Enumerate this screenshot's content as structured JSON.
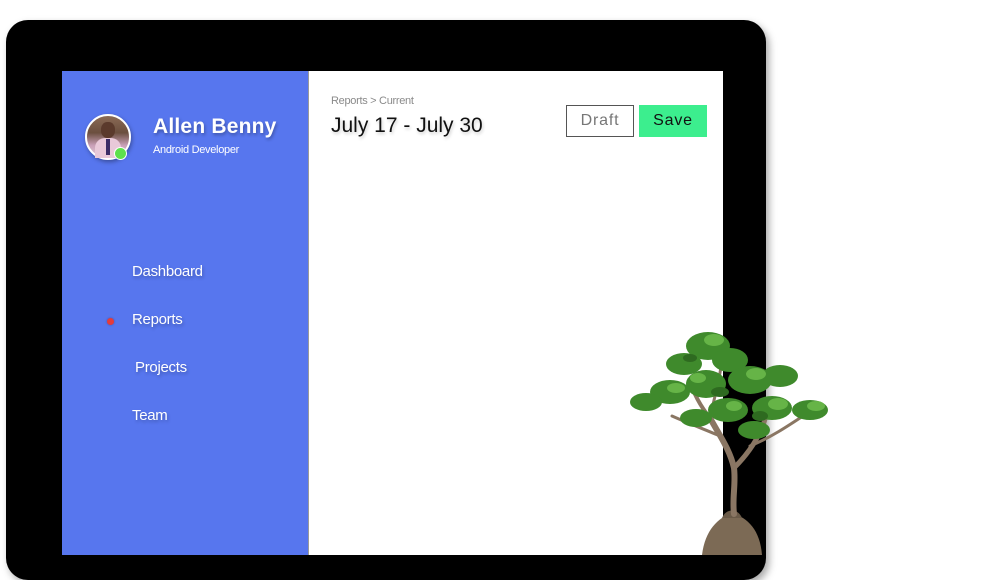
{
  "profile": {
    "name": "Allen Benny",
    "role": "Android Developer",
    "status": "online",
    "status_color": "#5ee04c"
  },
  "sidebar": {
    "background_color": "#5776ee",
    "items": [
      {
        "label": "Dashboard",
        "active": false
      },
      {
        "label": "Reports",
        "active": true
      },
      {
        "label": "Projects",
        "active": false
      },
      {
        "label": "Team",
        "active": false
      }
    ],
    "active_indicator_color": "#e53b3b"
  },
  "header": {
    "breadcrumb": "Reports > Current",
    "title": "July 17 - July 30"
  },
  "actions": {
    "draft_label": "Draft",
    "save_label": "Save",
    "save_color": "#3cee8e"
  },
  "decor": {
    "plant": "bonsai-plant-image",
    "avatar": "user-avatar-photo"
  }
}
